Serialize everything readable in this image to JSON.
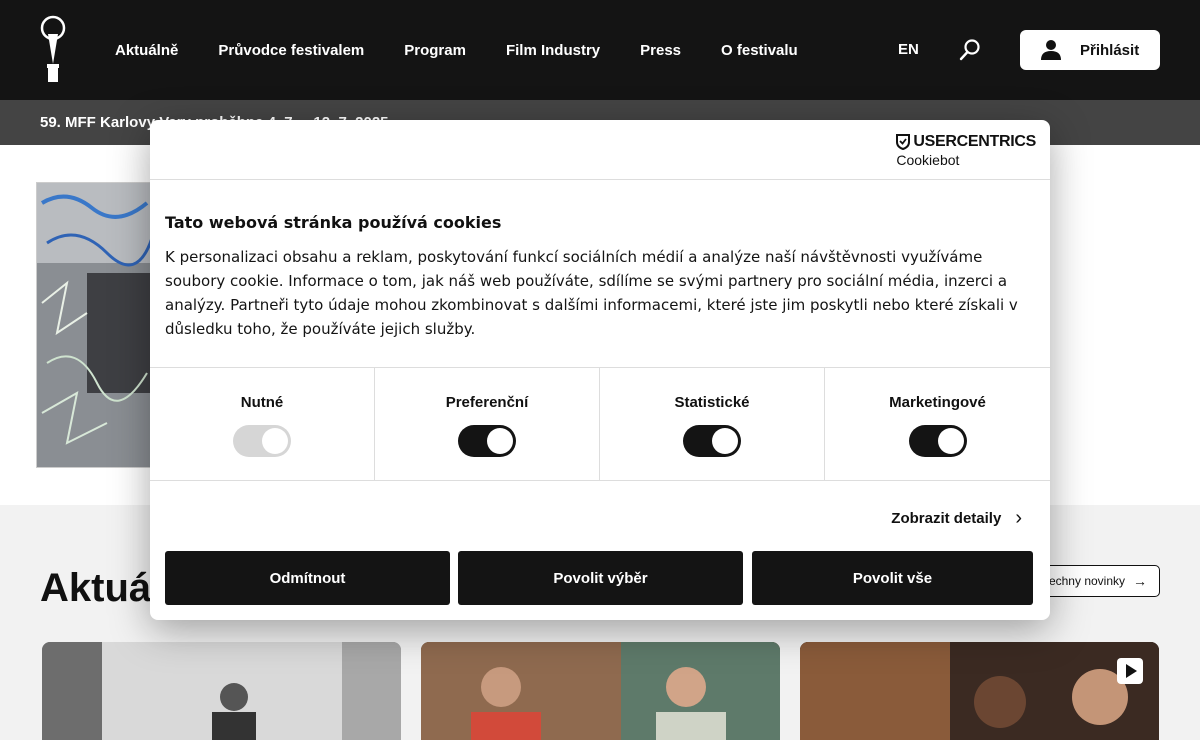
{
  "header": {
    "nav": [
      "Aktuálně",
      "Průvodce festivalem",
      "Program",
      "Film Industry",
      "Press",
      "O festivalu"
    ],
    "lang": "EN",
    "login_label": "Přihlásit"
  },
  "subbar": {
    "text": "59. MFF Karlovy Vary proběhne 4. 7. – 12. 7. 2025"
  },
  "page": {
    "news_title": "Aktuálně",
    "all_news_label": "Všechny novinky"
  },
  "cookie": {
    "brand_line1": "USERCENTRICS",
    "brand_line2": "Cookiebot",
    "title": "Tato webová stránka používá cookies",
    "body": "K personalizaci obsahu a reklam, poskytování funkcí sociálních médií a analýze naší návštěvnosti využíváme soubory cookie. Informace o tom, jak náš web používáte, sdílíme se svými partnery pro sociální média, inzerci a analýzy. Partneři tyto údaje mohou zkombinovat s dalšími informacemi, které jste jim poskytli nebo které získali v důsledku toho, že používáte jejich služby.",
    "categories": [
      {
        "label": "Nutné",
        "enabled": true,
        "locked": true
      },
      {
        "label": "Preferenční",
        "enabled": true,
        "locked": false
      },
      {
        "label": "Statistické",
        "enabled": true,
        "locked": false
      },
      {
        "label": "Marketingové",
        "enabled": true,
        "locked": false
      }
    ],
    "details_label": "Zobrazit detaily",
    "buttons": {
      "decline": "Odmítnout",
      "allow_selection": "Povolit výběr",
      "allow_all": "Povolit vše"
    }
  },
  "colors": {
    "header_bg": "#141414",
    "subbar_bg": "#444444",
    "button_bg": "#141414"
  }
}
